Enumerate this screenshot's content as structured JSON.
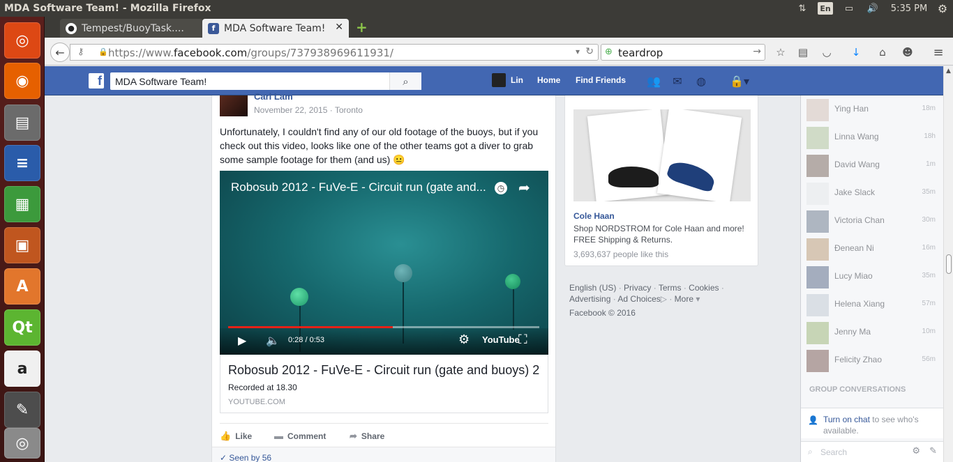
{
  "os": {
    "window_title": "MDA Software Team! - Mozilla Firefox",
    "lang": "En",
    "clock": "5:35 PM"
  },
  "browser": {
    "tabs": [
      {
        "label": "Tempest/BuoyTask...."
      },
      {
        "label": "MDA Software Team!"
      }
    ],
    "url_prefix": "https://www.",
    "url_domain": "facebook.com",
    "url_path": "/groups/737938969611931/",
    "search_value": "teardrop"
  },
  "fb": {
    "search_value": "MDA Software Team!",
    "nav": {
      "user": "Lin",
      "home": "Home",
      "find_friends": "Find Friends"
    }
  },
  "post": {
    "author": "Carl Lam",
    "meta": "November 22, 2015 · Toronto",
    "text": "Unfortunately, I couldn't find any of our old footage of the buoys, but if you check out this video, looks like one of the other teams got a diver to grab some sample footage for them (and us) 😐",
    "video": {
      "title": "Robosub 2012 - FuVe-E - Circuit run (gate and...",
      "time": "0:28 / 0:53",
      "progress": 0.53,
      "brand": "YouTube"
    },
    "link": {
      "title": "Robosub 2012 - FuVe-E - Circuit run (gate and buoys) 2",
      "description": "Recorded at 18.30",
      "source": "YOUTUBE.COM"
    },
    "actions": {
      "like": "Like",
      "comment": "Comment",
      "share": "Share"
    },
    "seen": "Seen by 56"
  },
  "ad": {
    "brand": "Cole Haan",
    "text": "Shop NORDSTROM for Cole Haan and more! FREE Shipping & Returns.",
    "likes": "3,693,637 people like this"
  },
  "footer": {
    "english": "English (US)",
    "privacy": "Privacy",
    "terms": "Terms",
    "cookies": "Cookies",
    "advertising": "Advertising",
    "ad_choices": "Ad Choices",
    "more": "More",
    "copyright": "Facebook © 2016"
  },
  "chat": {
    "contacts": [
      {
        "name": "Ying Han",
        "time": "18m"
      },
      {
        "name": "Linna Wang",
        "time": "18h"
      },
      {
        "name": "David Wang",
        "time": "1m"
      },
      {
        "name": "Jake Slack",
        "time": "35m"
      },
      {
        "name": "Victoria Chan",
        "time": "30m"
      },
      {
        "name": "Đenean Ni",
        "time": "16m"
      },
      {
        "name": "Lucy Miao",
        "time": "35m"
      },
      {
        "name": "Helena Xiang",
        "time": "57m"
      },
      {
        "name": "Jenny Ma",
        "time": "10m"
      },
      {
        "name": "Felicity Zhao",
        "time": "56m"
      }
    ],
    "group_conversations": "GROUP CONVERSATIONS",
    "turn_on_link": "Turn on chat",
    "turn_on_rest": " to see who's available.",
    "search_placeholder": "Search"
  }
}
